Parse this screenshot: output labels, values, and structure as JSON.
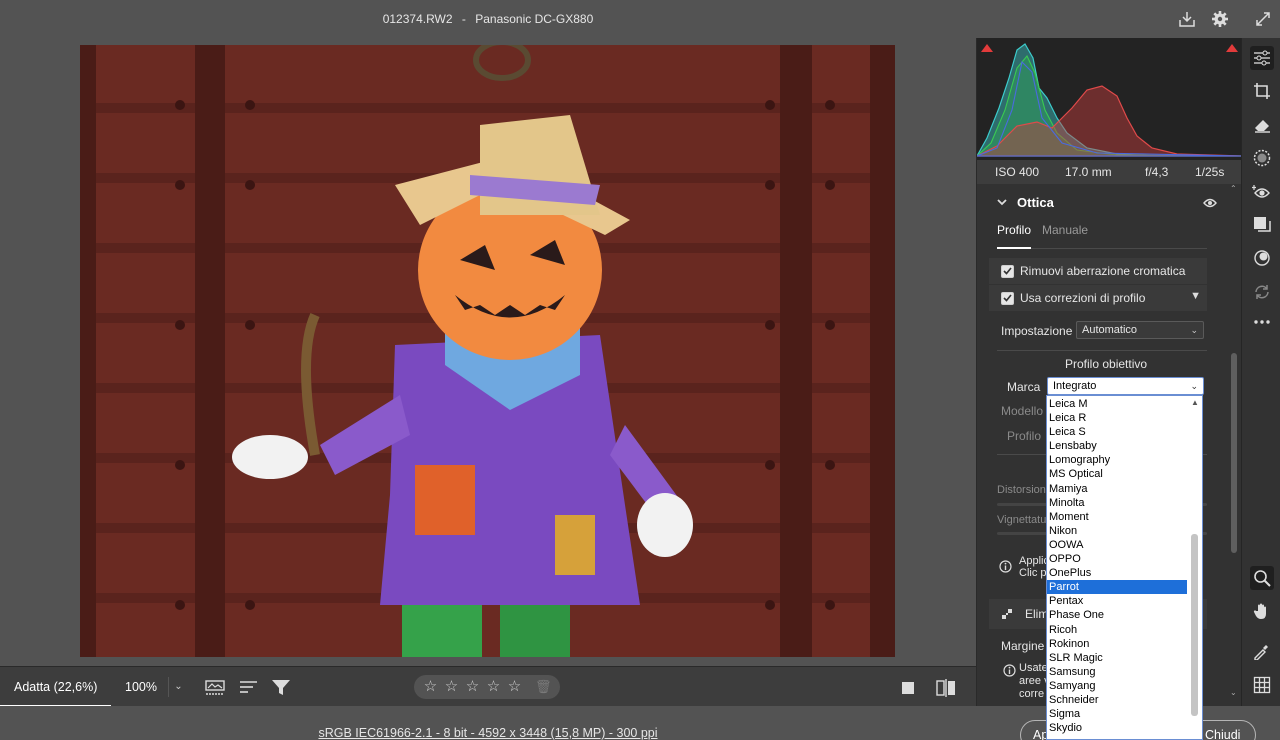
{
  "title": {
    "filename": "012374.RW2",
    "separator": "-",
    "camera": "Panasonic DC-GX880"
  },
  "bottom_bar": {
    "fit_label": "Adatta (22,6%)",
    "zoom_value": "100%",
    "stars": [
      "☆",
      "☆",
      "☆",
      "☆",
      "☆"
    ]
  },
  "status": {
    "file_info": "sRGB IEC61966-2.1 - 8 bit - 4592 x 3448 (15,8 MP) - 300 ppi",
    "open_button": "Ap",
    "close_button": "Chiudi"
  },
  "exif": {
    "iso": "ISO 400",
    "focal": "17.0 mm",
    "aperture": "f/4,3",
    "shutter": "1/25s"
  },
  "panel": {
    "section_title": "Ottica",
    "tabs": [
      {
        "label": "Profilo",
        "active": true
      },
      {
        "label": "Manuale",
        "active": false
      }
    ],
    "chk_chromatic": {
      "label": "Rimuovi aberrazione cromatica",
      "checked": true
    },
    "chk_profile": {
      "label": "Usa correzioni di profilo",
      "checked": true
    },
    "setting_label": "Impostazione",
    "setting_value": "Automatico",
    "lens_profile_heading": "Profilo obiettivo",
    "make_label": "Marca",
    "make_value": "Integrato",
    "model_label": "Modello",
    "profile_label": "Profilo",
    "distortion_label": "Distorsione",
    "vignetting_label": "Vignettatura",
    "info1_line1": "Applic",
    "info1_line2": "Clic pe",
    "section2_title": "Elimi",
    "margin_label": "Margine c",
    "info2_line1": "Usate",
    "info2_line2": "aree v",
    "info2_line3": "corre"
  },
  "dropdown": {
    "items": [
      "Leica M",
      "Leica R",
      "Leica S",
      "Lensbaby",
      "Lomography",
      "MS Optical",
      "Mamiya",
      "Minolta",
      "Moment",
      "Nikon",
      "OOWA",
      "OPPO",
      "OnePlus",
      "Parrot",
      "Pentax",
      "Phase One",
      "Ricoh",
      "Rokinon",
      "SLR Magic",
      "Samsung",
      "Samyang",
      "Schneider",
      "Sigma",
      "Skydio"
    ],
    "selected": "Parrot"
  },
  "colors": {
    "accent": "#1e6fd9",
    "panel_bg": "#323232",
    "app_bg": "#535353",
    "clip_warning": "#e23b3b"
  },
  "icons": {
    "titlebar": [
      "save-icon",
      "gear-icon",
      "fullscreen-icon"
    ],
    "tools": [
      "edit-sliders-icon",
      "crop-icon",
      "eraser-icon",
      "mask-icon",
      "redeye-icon",
      "snapshots-icon",
      "presets-icon",
      "sync-icon",
      "more-icon",
      "zoom-icon",
      "hand-icon",
      "color-sampler-icon",
      "grid-icon"
    ]
  }
}
